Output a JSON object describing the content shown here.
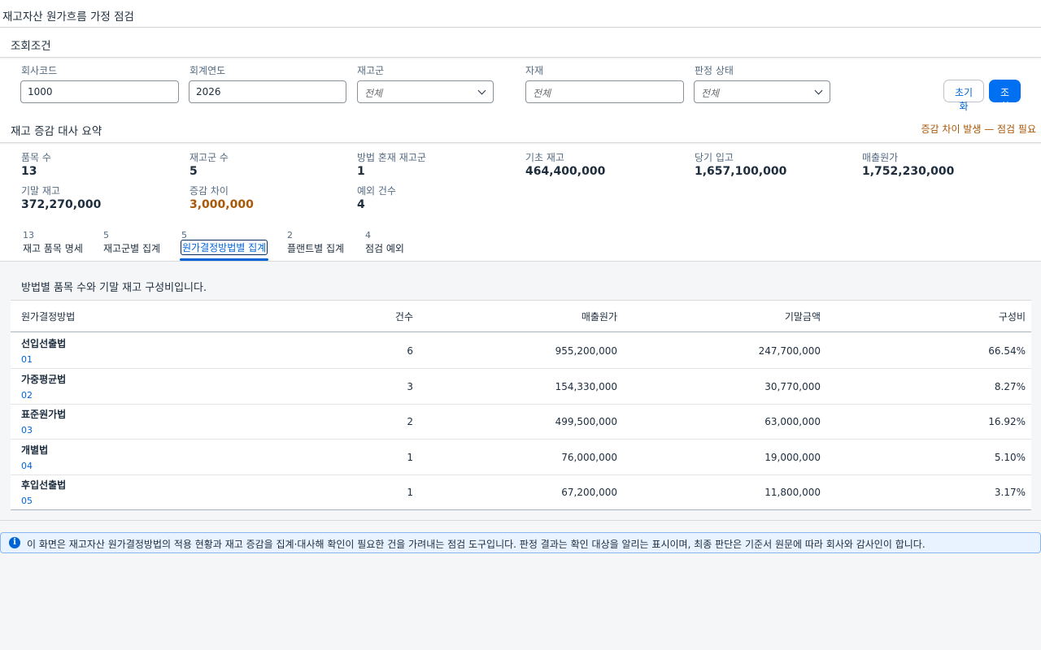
{
  "page": {
    "title": "재고자산 원가흐름 가정 점검"
  },
  "filter": {
    "title": "조회조건",
    "fields": [
      {
        "label": "회사코드",
        "value": "1000"
      },
      {
        "label": "회계연도",
        "value": "2026"
      },
      {
        "label": "재고군",
        "placeholder": "전체"
      },
      {
        "label": "자재",
        "placeholder": "전체"
      },
      {
        "label": "판정 상태",
        "placeholder": "전체"
      }
    ],
    "reset_label": "초기화",
    "search_label": "조회"
  },
  "summary": {
    "title": "재고 증감 대사 요약",
    "alert": "증감 차이 발생 — 점검 필요",
    "kpis": [
      {
        "label": "품목 수",
        "value": "13"
      },
      {
        "label": "재고군 수",
        "value": "5"
      },
      {
        "label": "방법 혼재 재고군",
        "value": "1"
      },
      {
        "label": "기초 재고",
        "value": "464,400,000"
      },
      {
        "label": "당기 입고",
        "value": "1,657,100,000"
      },
      {
        "label": "매출원가",
        "value": "1,752,230,000"
      },
      {
        "label": "기말 재고",
        "value": "372,270,000"
      },
      {
        "label": "증감 차이",
        "value": "3,000,000"
      },
      {
        "label": "예외 건수",
        "value": "4"
      }
    ],
    "warn_color": "#aa5808"
  },
  "tabs": [
    {
      "count": "13",
      "label": "재고 품목 명세"
    },
    {
      "count": "5",
      "label": "재고군별 집계"
    },
    {
      "count": "5",
      "label": "원가결정방법별 집계",
      "active": true
    },
    {
      "count": "2",
      "label": "플랜트별 집계"
    },
    {
      "count": "4",
      "label": "점검 예외"
    }
  ],
  "description": "방법별 품목 수와 기말 재고 구성비입니다.",
  "table": {
    "headers": [
      "원가결정방법",
      "건수",
      "매출원가",
      "기말금액",
      "구성비"
    ],
    "rows": [
      {
        "name": "선입선출법",
        "code": "01",
        "count": "6",
        "cogs": "955,200,000",
        "ending": "247,700,000",
        "ratio": "66.54%"
      },
      {
        "name": "가중평균법",
        "code": "02",
        "count": "3",
        "cogs": "154,330,000",
        "ending": "30,770,000",
        "ratio": "8.27%"
      },
      {
        "name": "표준원가법",
        "code": "03",
        "count": "2",
        "cogs": "499,500,000",
        "ending": "63,000,000",
        "ratio": "16.92%"
      },
      {
        "name": "개별법",
        "code": "04",
        "count": "1",
        "cogs": "76,000,000",
        "ending": "19,000,000",
        "ratio": "5.10%"
      },
      {
        "name": "후입선출법",
        "code": "05",
        "count": "1",
        "cogs": "67,200,000",
        "ending": "11,800,000",
        "ratio": "3.17%"
      }
    ]
  },
  "info": {
    "icon": "info-icon",
    "text": "이 화면은 재고자산 원가결정방법의 적용 현황과 재고 증감을 집계·대사해 확인이 필요한 건을 가려내는 점검 도구입니다. 판정 결과는 확인 대상을 알리는 표시이며, 최종 판단은 기준서 원문에 따라 회사와 감사인이 합니다."
  },
  "colors": {
    "accent": "#0070f2",
    "link": "#0064d9",
    "warning": "#aa5808",
    "info_bg": "#e8f3ff"
  }
}
